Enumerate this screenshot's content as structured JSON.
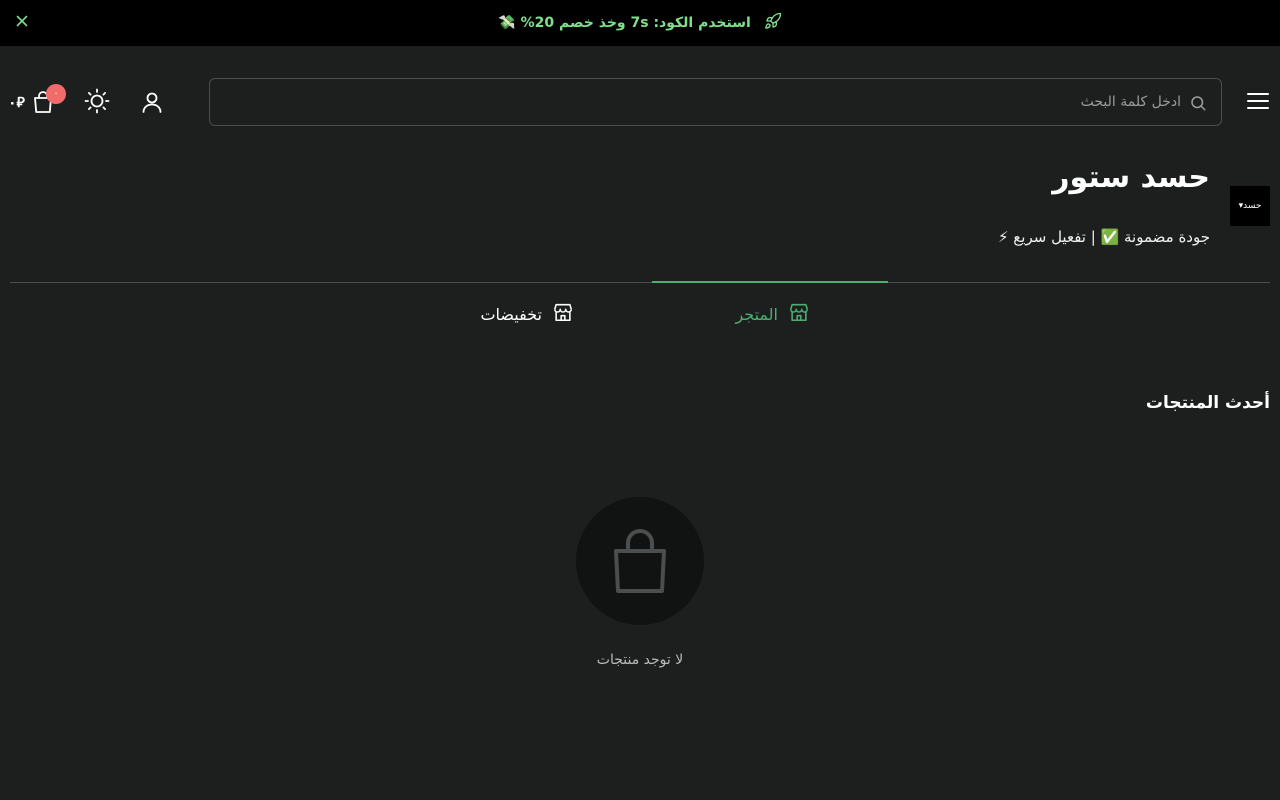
{
  "banner": {
    "text": "استخدم الكود: 7s وخذ خصم 20% 💸",
    "rocket_icon": "rocket-icon",
    "close_icon": "close-icon",
    "accent_color": "#7ee08a"
  },
  "header": {
    "menu_icon": "hamburger-menu-icon",
    "search": {
      "placeholder": "ادخل كلمة البحث",
      "value": "",
      "icon": "search-icon"
    },
    "user_icon": "user-icon",
    "theme_icon": "sun-icon",
    "cart": {
      "icon": "shopping-bag-icon",
      "count": "٠",
      "total": "٠⃁",
      "badge_color": "#f16b6b"
    }
  },
  "store": {
    "logo_text": "▾حسد",
    "name": "حسد ستور",
    "description": "جودة مضمونة ✅ | تفعيل سريع ⚡"
  },
  "tabs": [
    {
      "label": "المتجر",
      "icon": "store-icon",
      "active": true
    },
    {
      "label": "تخفيضات",
      "icon": "store-icon",
      "active": false
    }
  ],
  "tab_active_color": "#4caf70",
  "products_section": {
    "title": "أحدث المنتجات",
    "empty_icon": "shopping-bag-icon",
    "empty_text": "لا توجد منتجات"
  }
}
